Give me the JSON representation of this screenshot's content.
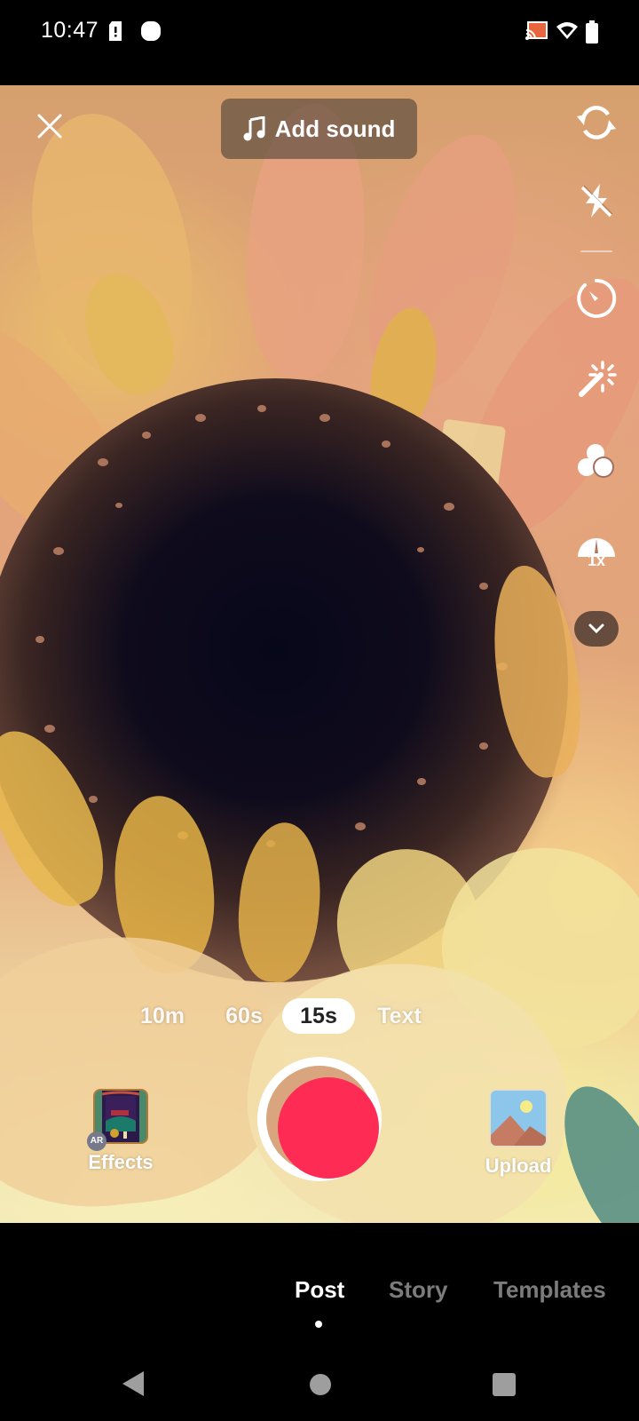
{
  "status_bar": {
    "time": "10:47",
    "left_icons": [
      "sim-alert-icon",
      "notification-icon"
    ],
    "right_icons": [
      "cast-icon",
      "wifi-icon",
      "battery-icon"
    ]
  },
  "camera": {
    "close_icon": "close-icon",
    "add_sound": {
      "icon": "music-note-icon",
      "label": "Add sound"
    },
    "side_tools": [
      {
        "name": "flip-camera",
        "icon": "flip-camera-icon"
      },
      {
        "name": "flash",
        "icon": "flash-off-icon"
      },
      {
        "name": "timer",
        "icon": "timer-icon"
      },
      {
        "name": "enhance",
        "icon": "magic-wand-icon"
      },
      {
        "name": "filters",
        "icon": "filters-icon"
      },
      {
        "name": "speed",
        "icon": "speed-gauge-icon",
        "label": "1x"
      },
      {
        "name": "more",
        "icon": "chevron-down-icon"
      }
    ],
    "modes": [
      {
        "label": "10m",
        "active": false
      },
      {
        "label": "60s",
        "active": false
      },
      {
        "label": "15s",
        "active": true
      },
      {
        "label": "Text",
        "active": false
      }
    ],
    "effects": {
      "label": "Effects",
      "badge": "AR"
    },
    "upload": {
      "label": "Upload"
    },
    "record_color": "#fe2c55"
  },
  "bottom_tabs": [
    {
      "label": "Post",
      "active": true
    },
    {
      "label": "Story",
      "active": false
    },
    {
      "label": "Templates",
      "active": false
    }
  ],
  "nav_bar": [
    "back-icon",
    "home-icon",
    "recents-icon"
  ]
}
